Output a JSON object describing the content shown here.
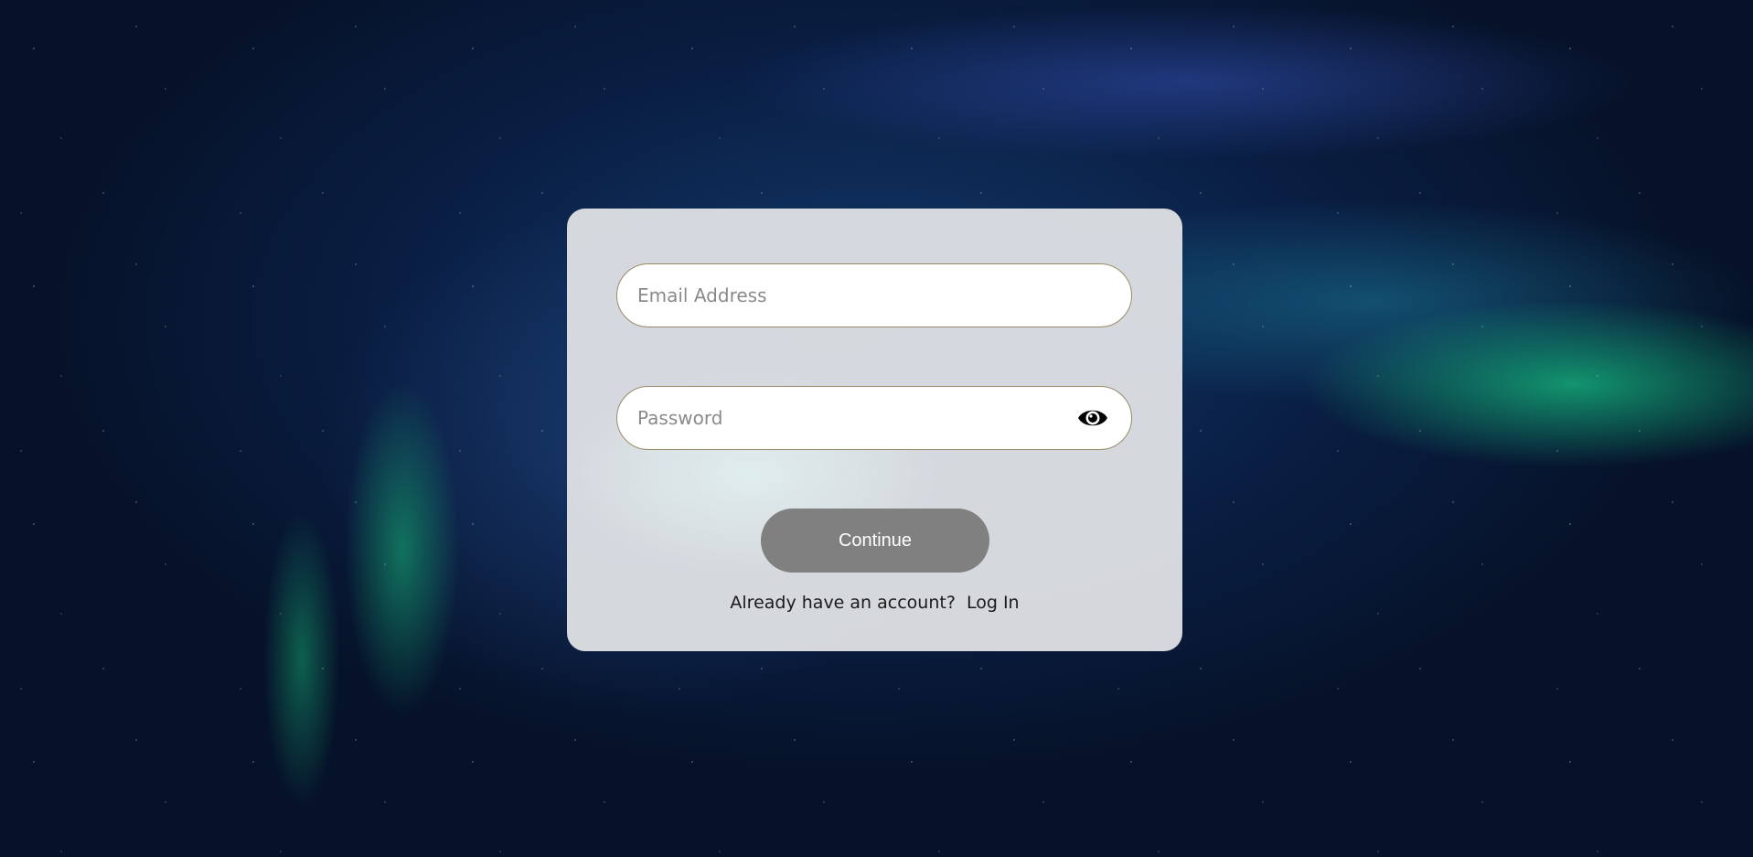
{
  "form": {
    "email": {
      "placeholder": "Email Address",
      "value": ""
    },
    "password": {
      "placeholder": "Password",
      "value": "",
      "toggle_icon": "eye-icon"
    },
    "continue_label": "Continue",
    "footer": {
      "prompt": "Already have an account?",
      "login_label": "Log In"
    }
  },
  "colors": {
    "button_bg": "#808080",
    "input_border": "#9a8a6a",
    "card_bg": "#dcdee2"
  }
}
